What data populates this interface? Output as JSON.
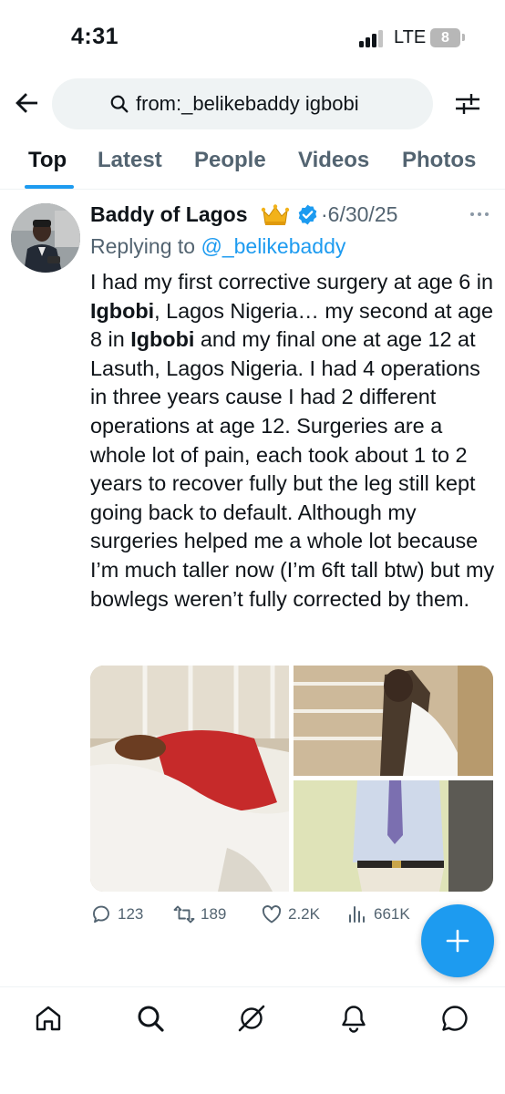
{
  "status_bar": {
    "time": "4:31",
    "network": "LTE",
    "battery": "8"
  },
  "search": {
    "query": "from:_belikebaddy igbobi"
  },
  "tabs": [
    {
      "label": "Top",
      "active": true
    },
    {
      "label": "Latest",
      "active": false
    },
    {
      "label": "People",
      "active": false
    },
    {
      "label": "Videos",
      "active": false
    },
    {
      "label": "Photos",
      "active": false
    }
  ],
  "tweet": {
    "author_name": "Baddy of Lagos",
    "name_emoji": "crown-icon",
    "verified": true,
    "date_separator": "·",
    "date": "6/30/25",
    "replying_to_label": "Replying to",
    "replying_to_handle": "@_belikebaddy",
    "body": [
      {
        "text": "I had my first corrective surgery at age 6 in ",
        "bold": false
      },
      {
        "text": "Igbobi",
        "bold": true
      },
      {
        "text": ", Lagos Nigeria… my second at age 8 in ",
        "bold": false
      },
      {
        "text": "Igbobi",
        "bold": true
      },
      {
        "text": " and my final one at age 12 at Lasuth, Lagos Nigeria. I had 4 operations in three years cause I had 2 different operations at age 12. Surgeries are a whole lot of pain, each took about 1 to 2 years to recover fully but the leg still kept going back to default. Although my surgeries helped me a whole lot because I’m much taller now (I’m 6ft tall btw) but my bowlegs weren’t fully corrected by them.",
        "bold": false
      }
    ],
    "media_count": 3,
    "actions": {
      "replies": "123",
      "reposts": "189",
      "likes": "2.2K",
      "views": "661K"
    }
  },
  "colors": {
    "accent": "#1d9bf0",
    "text_primary": "#0f1419",
    "text_secondary": "#536471",
    "verified_badge": "#1d9bf0"
  },
  "bottom_nav": [
    "home-icon",
    "search-icon",
    "grok-icon",
    "notifications-icon",
    "messages-icon"
  ]
}
